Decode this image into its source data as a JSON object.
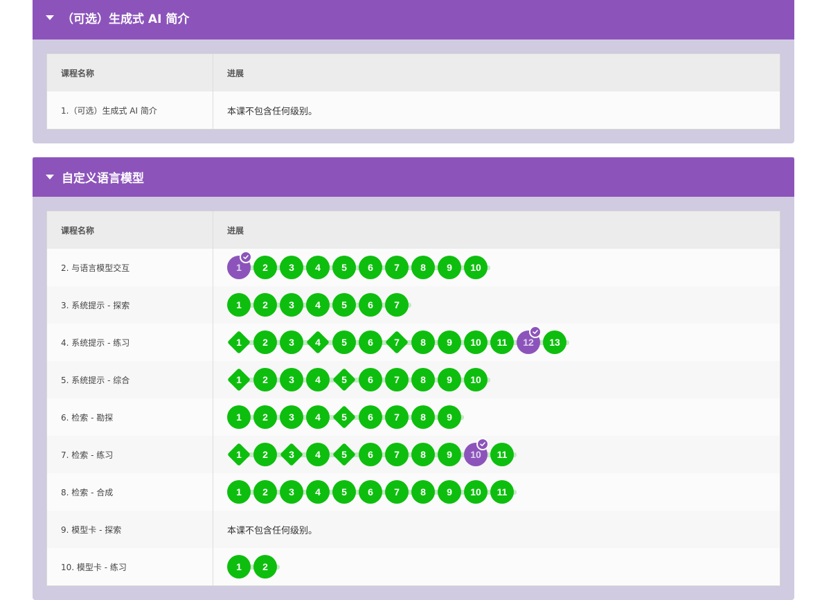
{
  "units": [
    {
      "title": "（可选）生成式 AI 简介",
      "header": {
        "name": "课程名称",
        "progress": "进展"
      },
      "lessons": [
        {
          "name": "1.（可选）生成式 AI 简介",
          "no_levels_text": "本课不包含任何级别。"
        }
      ]
    },
    {
      "title": "自定义语言模型",
      "header": {
        "name": "课程名称",
        "progress": "进展"
      },
      "lessons": [
        {
          "name": "2. 与语言模型交互",
          "levels": [
            {
              "n": "1",
              "shape": "circle",
              "current": true
            },
            {
              "n": "2"
            },
            {
              "n": "3"
            },
            {
              "n": "4"
            },
            {
              "n": "5"
            },
            {
              "n": "6"
            },
            {
              "n": "7"
            },
            {
              "n": "8"
            },
            {
              "n": "9"
            },
            {
              "n": "10"
            }
          ]
        },
        {
          "name": "3. 系统提示 - 探索",
          "levels": [
            {
              "n": "1"
            },
            {
              "n": "2"
            },
            {
              "n": "3"
            },
            {
              "n": "4"
            },
            {
              "n": "5"
            },
            {
              "n": "6"
            },
            {
              "n": "7"
            }
          ]
        },
        {
          "name": "4. 系统提示 - 练习",
          "levels": [
            {
              "n": "1",
              "shape": "diamond"
            },
            {
              "n": "2"
            },
            {
              "n": "3"
            },
            {
              "n": "4",
              "shape": "diamond"
            },
            {
              "n": "5"
            },
            {
              "n": "6"
            },
            {
              "n": "7",
              "shape": "diamond"
            },
            {
              "n": "8"
            },
            {
              "n": "9"
            },
            {
              "n": "10"
            },
            {
              "n": "11"
            },
            {
              "n": "12",
              "current": true
            },
            {
              "n": "13"
            }
          ]
        },
        {
          "name": "5. 系统提示 - 综合",
          "levels": [
            {
              "n": "1",
              "shape": "diamond"
            },
            {
              "n": "2"
            },
            {
              "n": "3"
            },
            {
              "n": "4"
            },
            {
              "n": "5",
              "shape": "diamond"
            },
            {
              "n": "6"
            },
            {
              "n": "7"
            },
            {
              "n": "8"
            },
            {
              "n": "9"
            },
            {
              "n": "10"
            }
          ]
        },
        {
          "name": "6. 检索 - 勘探",
          "levels": [
            {
              "n": "1"
            },
            {
              "n": "2"
            },
            {
              "n": "3"
            },
            {
              "n": "4"
            },
            {
              "n": "5",
              "shape": "diamond"
            },
            {
              "n": "6"
            },
            {
              "n": "7"
            },
            {
              "n": "8"
            },
            {
              "n": "9"
            }
          ]
        },
        {
          "name": "7. 检索 - 练习",
          "levels": [
            {
              "n": "1",
              "shape": "diamond"
            },
            {
              "n": "2"
            },
            {
              "n": "3",
              "shape": "diamond"
            },
            {
              "n": "4"
            },
            {
              "n": "5",
              "shape": "diamond"
            },
            {
              "n": "6"
            },
            {
              "n": "7"
            },
            {
              "n": "8"
            },
            {
              "n": "9"
            },
            {
              "n": "10",
              "current": true
            },
            {
              "n": "11"
            }
          ]
        },
        {
          "name": "8. 检索 - 合成",
          "levels": [
            {
              "n": "1"
            },
            {
              "n": "2"
            },
            {
              "n": "3"
            },
            {
              "n": "4"
            },
            {
              "n": "5"
            },
            {
              "n": "6"
            },
            {
              "n": "7"
            },
            {
              "n": "8"
            },
            {
              "n": "9"
            },
            {
              "n": "10"
            },
            {
              "n": "11"
            }
          ]
        },
        {
          "name": "9. 模型卡 - 探索",
          "no_levels_text": "本课不包含任何级别。"
        },
        {
          "name": "10. 模型卡 - 练习",
          "levels": [
            {
              "n": "1"
            },
            {
              "n": "2"
            }
          ]
        }
      ]
    }
  ]
}
